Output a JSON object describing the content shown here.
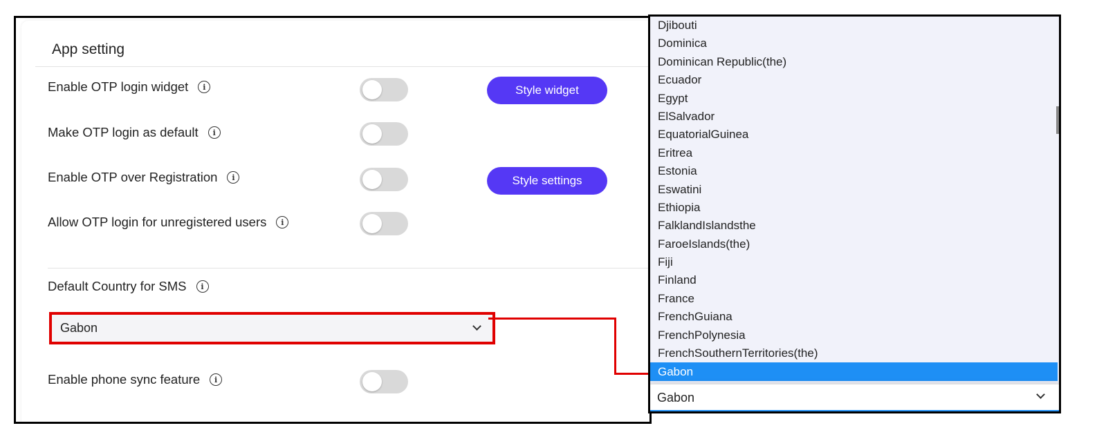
{
  "settings": {
    "title": "App setting",
    "rows": [
      {
        "label": "Enable OTP login widget",
        "toggle_on": false,
        "button": "Style widget"
      },
      {
        "label": "Make OTP login as default",
        "toggle_on": false
      },
      {
        "label": "Enable OTP over Registration",
        "toggle_on": false,
        "button": "Style settings"
      },
      {
        "label": "Allow OTP login for unregistered users",
        "toggle_on": false
      }
    ],
    "country_label": "Default Country for SMS",
    "country_value": "Gabon",
    "sync_label": "Enable phone sync feature",
    "sync_toggle_on": false,
    "info_glyph": "i"
  },
  "dropdown": {
    "options": [
      "Djibouti",
      "Dominica",
      "Dominican Republic(the)",
      "Ecuador",
      "Egypt",
      "ElSalvador",
      "EquatorialGuinea",
      "Eritrea",
      "Estonia",
      "Eswatini",
      "Ethiopia",
      "FalklandIslandsthe",
      "FaroeIslands(the)",
      "Fiji",
      "Finland",
      "France",
      "FrenchGuiana",
      "FrenchPolynesia",
      "FrenchSouthernTerritories(the)",
      "Gabon"
    ],
    "selected": "Gabon",
    "value": "Gabon"
  },
  "colors": {
    "accent": "#5538f5",
    "highlight": "#e00000",
    "selected_option": "#1e8ff5"
  }
}
